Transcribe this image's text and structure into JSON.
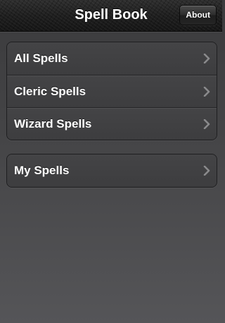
{
  "navbar": {
    "title": "Spell Book",
    "about_label": "About"
  },
  "groups": [
    {
      "items": [
        {
          "label": "All Spells"
        },
        {
          "label": "Cleric Spells"
        },
        {
          "label": "Wizard Spells"
        }
      ]
    },
    {
      "items": [
        {
          "label": "My Spells"
        }
      ]
    }
  ],
  "icons": {
    "row_accessory": "chevron-right-icon"
  }
}
